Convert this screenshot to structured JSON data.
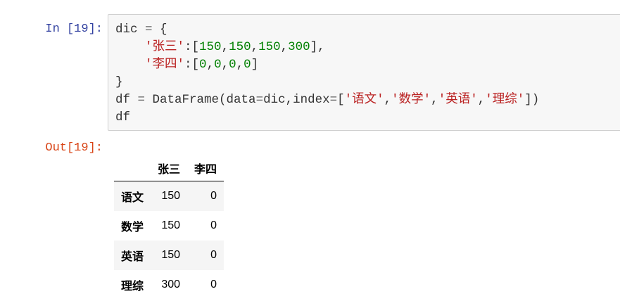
{
  "input_prompt": "In [19]:",
  "output_prompt": "Out[19]:",
  "code_lines": [
    [
      [
        "p",
        "dic "
      ],
      [
        "op",
        "="
      ],
      [
        "p",
        " {"
      ]
    ],
    [
      [
        "p",
        "    "
      ],
      [
        "str",
        "'张三'"
      ],
      [
        "p",
        ":["
      ],
      [
        "num",
        "150"
      ],
      [
        "p",
        ","
      ],
      [
        "num",
        "150"
      ],
      [
        "p",
        ","
      ],
      [
        "num",
        "150"
      ],
      [
        "p",
        ","
      ],
      [
        "num",
        "300"
      ],
      [
        "p",
        "],"
      ]
    ],
    [
      [
        "p",
        "    "
      ],
      [
        "str",
        "'李四'"
      ],
      [
        "p",
        ":["
      ],
      [
        "num",
        "0"
      ],
      [
        "p",
        ","
      ],
      [
        "num",
        "0"
      ],
      [
        "p",
        ","
      ],
      [
        "num",
        "0"
      ],
      [
        "p",
        ","
      ],
      [
        "num",
        "0"
      ],
      [
        "p",
        "]"
      ]
    ],
    [
      [
        "p",
        "}"
      ]
    ],
    [
      [
        "p",
        "df "
      ],
      [
        "op",
        "="
      ],
      [
        "p",
        " DataFrame(data"
      ],
      [
        "op",
        "="
      ],
      [
        "p",
        "dic,index"
      ],
      [
        "op",
        "="
      ],
      [
        "p",
        "["
      ],
      [
        "str",
        "'语文'"
      ],
      [
        "p",
        ","
      ],
      [
        "str",
        "'数学'"
      ],
      [
        "p",
        ","
      ],
      [
        "str",
        "'英语'"
      ],
      [
        "p",
        ","
      ],
      [
        "str",
        "'理综'"
      ],
      [
        "p",
        "])"
      ]
    ],
    [
      [
        "p",
        "df"
      ]
    ]
  ],
  "table": {
    "columns": [
      "",
      "张三",
      "李四"
    ],
    "rows": [
      {
        "index": "语文",
        "values": [
          "150",
          "0"
        ]
      },
      {
        "index": "数学",
        "values": [
          "150",
          "0"
        ]
      },
      {
        "index": "英语",
        "values": [
          "150",
          "0"
        ]
      },
      {
        "index": "理综",
        "values": [
          "300",
          "0"
        ]
      }
    ]
  }
}
